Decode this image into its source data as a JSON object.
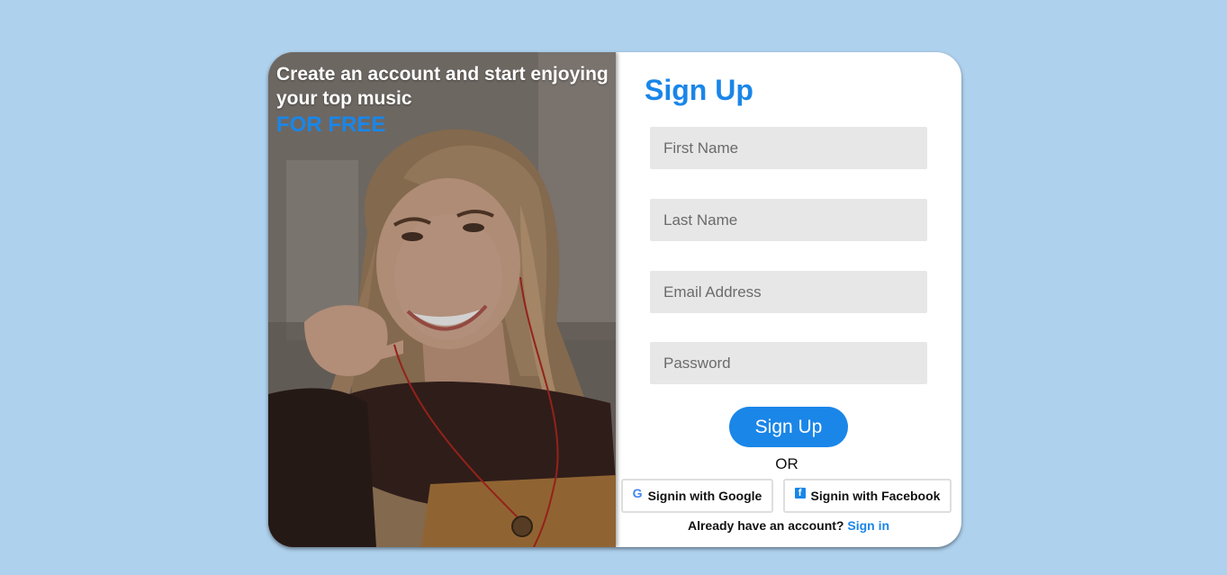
{
  "hero": {
    "tagline": "Create an account and start enjoying your top music",
    "highlight": "FOR FREE",
    "image": "woman-with-earphones-photo"
  },
  "form": {
    "title": "Sign Up",
    "fields": [
      {
        "placeholder": "First Name",
        "value": ""
      },
      {
        "placeholder": "Last Name",
        "value": ""
      },
      {
        "placeholder": "Email Address",
        "value": ""
      },
      {
        "placeholder": "Password",
        "value": ""
      }
    ],
    "submit_label": "Sign Up",
    "or_label": "OR",
    "google_label": "Signin with Google",
    "facebook_label": "Signin with Facebook",
    "google_icon": "google-icon",
    "facebook_icon": "facebook-icon",
    "already_text": "Already have an account?",
    "signin_label": "Sign in"
  },
  "colors": {
    "background": "#aed1ee",
    "accent": "#1a86e8",
    "field_bg": "#e7e7e7"
  }
}
